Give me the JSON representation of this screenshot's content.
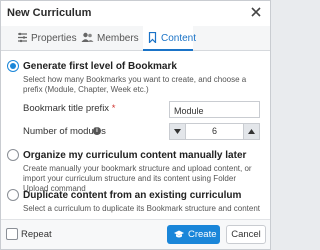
{
  "dialog": {
    "title": "New Curriculum",
    "close_icon": "close-icon"
  },
  "tabs": [
    {
      "label": "Properties",
      "icon": "properties-icon",
      "active": false
    },
    {
      "label": "Members",
      "icon": "members-icon",
      "active": false
    },
    {
      "label": "Content",
      "icon": "bookmark-icon",
      "active": true
    }
  ],
  "options": {
    "generate": {
      "title": "Generate first level of Bookmark",
      "description": "Select how many Bookmarks you want to create, and choose a prefix (Module, Chapter, Week etc.)",
      "selected": true,
      "prefix_label": "Bookmark title prefix",
      "prefix_required_mark": "*",
      "prefix_value": "Module",
      "modules_label": "Number of modules",
      "modules_value": "6"
    },
    "manual": {
      "title": "Organize my curriculum content manually later",
      "description": "Create manually your bookmark structure and upload content, or import your curriculum structure and its content using Folder Upload command",
      "selected": false
    },
    "duplicate": {
      "title": "Duplicate content from an existing curriculum",
      "description": "Select a curriculum to duplicate its Bookmark structure and content",
      "selected": false
    }
  },
  "footer": {
    "repeat_label": "Repeat",
    "repeat_checked": false,
    "create_label": "Create",
    "cancel_label": "Cancel"
  },
  "colors": {
    "accent": "#1a86d9",
    "required": "#d0312d"
  }
}
